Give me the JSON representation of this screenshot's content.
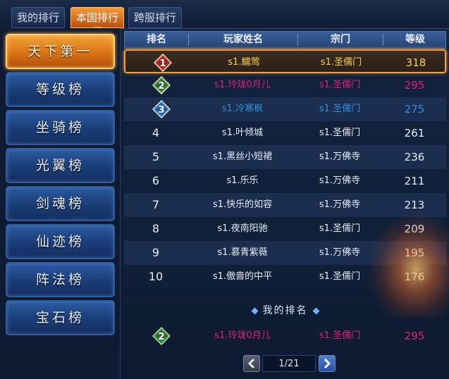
{
  "tabs": [
    {
      "label": "我的排行",
      "active": false
    },
    {
      "label": "本国排行",
      "active": true
    },
    {
      "label": "跨服排行",
      "active": false
    }
  ],
  "sidebar": {
    "items": [
      {
        "label": "天下第一",
        "active": true
      },
      {
        "label": "等级榜",
        "active": false
      },
      {
        "label": "坐骑榜",
        "active": false
      },
      {
        "label": "光翼榜",
        "active": false
      },
      {
        "label": "剑魂榜",
        "active": false
      },
      {
        "label": "仙迹榜",
        "active": false
      },
      {
        "label": "阵法榜",
        "active": false
      },
      {
        "label": "宝石榜",
        "active": false
      }
    ]
  },
  "table": {
    "headers": {
      "rank": "排名",
      "name": "玩家姓名",
      "sect": "宗门",
      "level": "等级"
    },
    "rows": [
      {
        "rank": "1",
        "name": "s1.鱬莺",
        "sect": "s1.圣儒门",
        "level": "318",
        "color": "#ffd24a"
      },
      {
        "rank": "2",
        "name": "s1.玲珑0月儿",
        "sect": "s1.圣儒门",
        "level": "295",
        "color": "#e0207f"
      },
      {
        "rank": "3",
        "name": "s1.冷寒枫",
        "sect": "s1.圣儒门",
        "level": "275",
        "color": "#2f8fe0"
      },
      {
        "rank": "4",
        "name": "s1.叶倾城",
        "sect": "s1.圣儒门",
        "level": "261",
        "color": "#e8ecf4"
      },
      {
        "rank": "5",
        "name": "s1.黑丝小短裙",
        "sect": "s1.万佛寺",
        "level": "236",
        "color": "#e8ecf4"
      },
      {
        "rank": "6",
        "name": "s1.乐乐",
        "sect": "s1.万佛寺",
        "level": "211",
        "color": "#e8ecf4"
      },
      {
        "rank": "7",
        "name": "s1.快乐的如容",
        "sect": "s1.万佛寺",
        "level": "213",
        "color": "#e8ecf4"
      },
      {
        "rank": "8",
        "name": "s1.夜南阳驰",
        "sect": "s1.圣儒门",
        "level": "209",
        "color": "#e8ecf4"
      },
      {
        "rank": "9",
        "name": "s1.慕青紫薇",
        "sect": "s1.万佛寺",
        "level": "195",
        "color": "#e8ecf4"
      },
      {
        "rank": "10",
        "name": "s1.傲啬的中平",
        "sect": "s1.圣儒门",
        "level": "176",
        "color": "#e8ecf4"
      }
    ]
  },
  "my_rank": {
    "title": "我的排名",
    "rank": "2",
    "name": "s1.玲珑0月儿",
    "sect": "s1.圣儒门",
    "level": "295",
    "color": "#e0207f"
  },
  "pager": {
    "display": "1/21"
  },
  "badge_colors": {
    "gold": "#c0302a",
    "silver": "#3f8a3f",
    "bronze": "#2f78c8"
  },
  "accent": "#f2a03c"
}
